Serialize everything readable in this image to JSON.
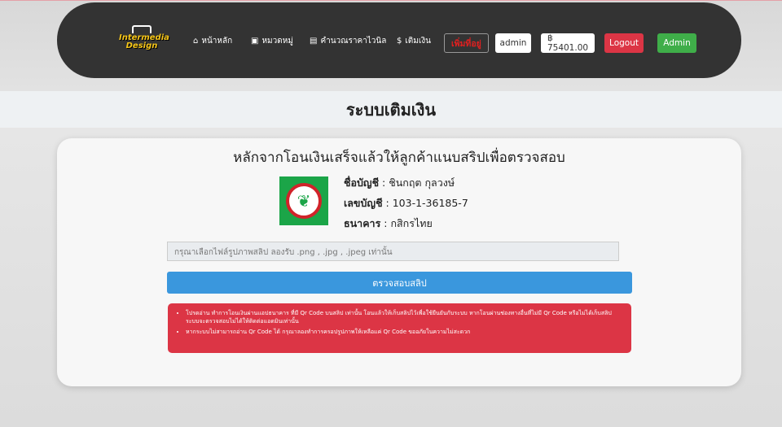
{
  "nav": {
    "logo": "Intermedia Design",
    "home": "หน้าหลัก",
    "category": "หมวดหมู่",
    "calc": "คำนวณราคาไวนิล",
    "topup": "เติมเงิน",
    "add_address": "เพิ่มที่อยู่",
    "user": "admin",
    "balance": "฿ 75401.00",
    "logout": "Logout",
    "admin": "Admin"
  },
  "page": {
    "title": "ระบบเติมเงิน",
    "heading": "หลักจากโอนเงินเสร็จแล้วให้ลูกค้าแนบสริปเพื่อตรวจสอบ"
  },
  "account": {
    "name_label": "ชื่อบัญชี",
    "name": " : ชินกฤต กุลวงษ์",
    "number_label": "เลขบัญชี",
    "number": " : 103-1-36185-7",
    "bank_label": "ธนาคาร",
    "bank": " : กสิกรไทย"
  },
  "form": {
    "file_placeholder": "กรุณาเลือกไฟล์รูปภาพสลิป ลองรับ .png , .jpg , .jpeg เท่านั้น",
    "check_button": "ตรวจสอบสลิป"
  },
  "notices": [
    "โปรดอ่าน ทำการโอนเงินผ่านแอปธนาคาร ที่มี Qr Code บนสลิป เท่านั้น โอนแล้วให้เก็บสลิปไว้เพื่อใช้ยืนยันกับระบบ หากโอนผ่านช่องทางอื่นที่ไม่มี Qr Code หรือไม่ได้เก็บสลิป ระบบจะตรวจสอบไม่ได้ให้ติดต่อแอดมินเท่านั้น",
    "หากระบบไม่สามารถอ่าน Qr Code ได้ กรุณาลองทำการครอปรูปภาพให้เหลือแค่ Qr Code ขออภัยในความไม่สะดวก"
  ]
}
